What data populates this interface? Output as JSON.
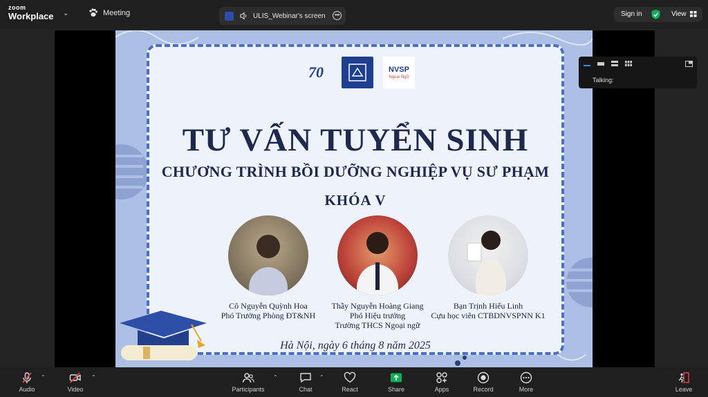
{
  "topbar": {
    "brand_line1": "zoom",
    "brand_line2": "Workplace",
    "meeting_label": "Meeting",
    "share_tab_label": "ULIS_Webinar's screen",
    "signin_label": "Sign in",
    "view_label": "View"
  },
  "slide": {
    "logo_70": "70",
    "logo_nvsp": "NVSP",
    "logo_nvsp_sub": "Ngoại Ngữ",
    "title_main": "TƯ VẤN TUYỂN SINH",
    "title_sub": "CHƯƠNG TRÌNH BỒI DƯỠNG NGHIỆP VỤ SƯ PHẠM",
    "title_course": "KHÓA  V",
    "people": [
      {
        "line1": "Cô Nguyễn Quỳnh Hoa",
        "line2": "Phó Trưởng Phòng ĐT&NH",
        "line3": ""
      },
      {
        "line1": "Thầy Nguyễn Hoàng Giang",
        "line2": "Phó Hiệu trưởng",
        "line3": "Trường THCS Ngoại ngữ"
      },
      {
        "line1": "Bạn Trịnh Hiếu Linh",
        "line2": "Cựu học viên CTBDNVSPNN K1",
        "line3": ""
      }
    ],
    "date_line": "Hà Nội, ngày 6 tháng 8 năm 2025"
  },
  "talk_panel": {
    "label": "Talking:"
  },
  "toolbar": {
    "audio": "Audio",
    "video": "Video",
    "participants": "Participants",
    "chat": "Chat",
    "react": "React",
    "share": "Share",
    "apps": "Apps",
    "record": "Record",
    "more": "More",
    "leave": "Leave"
  },
  "colors": {
    "accent_green": "#0bb057",
    "leave_red": "#e8464b",
    "slide_border": "#4a6fc4",
    "title_navy": "#1d2a4e"
  }
}
